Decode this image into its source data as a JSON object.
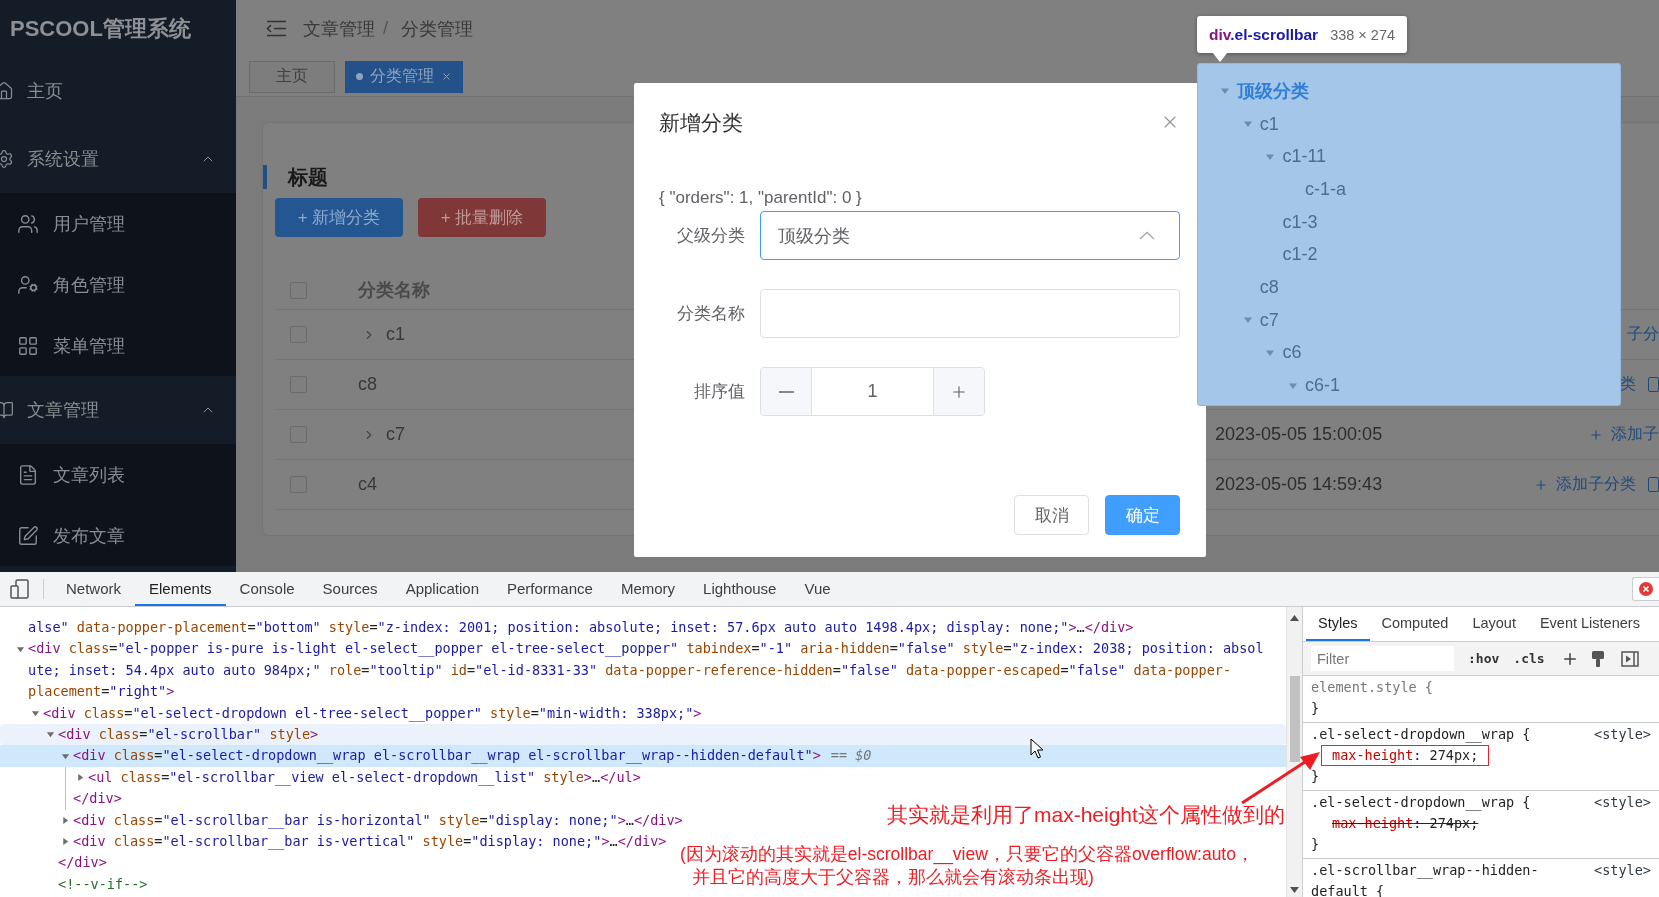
{
  "sidebar": {
    "logo": "PSCOOL管理系统",
    "items": [
      {
        "label": "主页"
      },
      {
        "label": "系统设置",
        "expanded": true,
        "children": [
          {
            "label": "用户管理"
          },
          {
            "label": "角色管理"
          },
          {
            "label": "菜单管理"
          }
        ]
      },
      {
        "label": "文章管理",
        "expanded": true,
        "children": [
          {
            "label": "文章列表"
          },
          {
            "label": "发布文章"
          }
        ]
      }
    ]
  },
  "header": {
    "breadcrumb": [
      "文章管理",
      "分类管理"
    ],
    "separator": "/"
  },
  "tabs": [
    {
      "label": "主页",
      "selected": false
    },
    {
      "label": "分类管理",
      "selected": true
    }
  ],
  "card": {
    "title": "标题",
    "buttons": [
      {
        "label": "+ 新增分类",
        "kind": "primary"
      },
      {
        "label": "+ 批量删除",
        "kind": "danger"
      }
    ],
    "table": {
      "header_checked": false,
      "columns": [
        "分类名称"
      ],
      "rows": [
        {
          "checked": false,
          "name": "c1",
          "expanded": false,
          "action": {
            "text": "子分",
            "kind": "text"
          }
        },
        {
          "checked": false,
          "name": "c8",
          "action": {
            "text": "类",
            "kind": "text-edit"
          }
        },
        {
          "checked": false,
          "name": "c7",
          "expanded": false,
          "date": "2023-05-05 15:00:05",
          "action": {
            "text": "添加子",
            "kind": "plus-text"
          }
        },
        {
          "checked": false,
          "name": "c4",
          "date": "2023-05-05 14:59:43",
          "action": {
            "text": "添加子分类",
            "kind": "plus-text-edit"
          }
        }
      ]
    }
  },
  "dialog": {
    "title": "新增分类",
    "debug_text": "{ \"orders\": 1, \"parentId\": 0 }",
    "fields": [
      {
        "kind": "select",
        "label": "父级分类",
        "value": "顶级分类",
        "open": true
      },
      {
        "kind": "text",
        "label": "分类名称"
      },
      {
        "kind": "number",
        "label": "排序值",
        "value": "1"
      }
    ],
    "buttons": [
      {
        "label": "取消",
        "kind": "default"
      },
      {
        "label": "确定",
        "kind": "primary"
      }
    ]
  },
  "tree_popper": {
    "nodes": [
      {
        "label": "顶级分类",
        "selected": true,
        "expanded": true,
        "children": [
          {
            "label": "c1",
            "selected": false,
            "expanded": true,
            "children": [
              {
                "label": "c1-11",
                "selected": false,
                "expanded": true,
                "children": [
                  {
                    "label": "c-1-a",
                    "selected": false
                  }
                ]
              },
              {
                "label": "c1-3",
                "selected": false
              },
              {
                "label": "c1-2",
                "selected": false
              }
            ]
          },
          {
            "label": "c8",
            "selected": false
          },
          {
            "label": "c7",
            "selected": false,
            "expanded": true,
            "children": [
              {
                "label": "c6",
                "selected": false,
                "expanded": true,
                "children": [
                  {
                    "label": "c6-1",
                    "selected": false,
                    "expanded": true
                  }
                ]
              }
            ]
          }
        ]
      }
    ]
  },
  "inspect_tooltip": {
    "tag": "div",
    "class": ".el-scrollbar",
    "size": "338 × 274"
  },
  "devtools": {
    "tabs": [
      {
        "label": "Network",
        "selected": false
      },
      {
        "label": "Elements",
        "selected": true
      },
      {
        "label": "Console",
        "selected": false
      },
      {
        "label": "Sources",
        "selected": false
      },
      {
        "label": "Application",
        "selected": false
      },
      {
        "label": "Performance",
        "selected": false
      },
      {
        "label": "Memory",
        "selected": false
      },
      {
        "label": "Lighthouse",
        "selected": false
      },
      {
        "label": "Vue",
        "selected": false
      }
    ],
    "elements": {
      "nodes": [
        {
          "lines": [
            {
              "text": "alse\" data-popper-placement=\"bottom\" style=\"z-index: 2001; position: absolute; inset: 57.6px auto auto 1498.4px; display: none;\">…</div>"
            }
          ],
          "selected": false,
          "hovered": false
        },
        {
          "lines": [
            {
              "text": "<div class=\"el-popper is-pure is-light el-select__popper el-tree-select__popper\" tabindex=\"-1\" aria-hidden=\"false\" style=\"z-index: 2038; position: absol"
            },
            {
              "text": "ute; inset: 54.4px auto auto 984px;\" role=\"tooltip\" id=\"el-id-8331-33\" data-popper-reference-hidden=\"false\" data-popper-escaped=\"false\" data-popper-"
            },
            {
              "text": "placement=\"right\">"
            }
          ],
          "expanded": true,
          "selected": false,
          "hovered": false,
          "children": [
            {
              "lines": [
                {
                  "text": "<div class=\"el-select-dropdown el-tree-select__popper\" style=\"min-width: 338px;\">"
                }
              ],
              "expanded": true,
              "selected": false,
              "hovered": false,
              "children": [
                {
                  "lines": [
                    {
                      "text": "<div class=\"el-scrollbar\" style>"
                    }
                  ],
                  "expanded": true,
                  "selected": false,
                  "hovered": true,
                  "closing": "</div>",
                  "children": [
                    {
                      "lines": [
                        {
                          "text": "<div class=\"el-select-dropdown__wrap el-scrollbar__wrap el-scrollbar__wrap--hidden-default\">"
                        }
                      ],
                      "marker": "== $0",
                      "expanded": true,
                      "selected": true,
                      "hovered": false,
                      "closing": "</div>",
                      "children": [
                        {
                          "lines": [
                            {
                              "text": "<ul class=\"el-scrollbar__view el-select-dropdown__list\" style>…</ul>"
                            }
                          ],
                          "expanded": false,
                          "selected": false,
                          "hovered": false
                        }
                      ]
                    },
                    {
                      "lines": [
                        {
                          "text": "<div class=\"el-scrollbar__bar is-horizontal\" style=\"display: none;\">…</div>"
                        }
                      ],
                      "expanded": false,
                      "selected": false,
                      "hovered": false
                    },
                    {
                      "lines": [
                        {
                          "text": "<div class=\"el-scrollbar__bar is-vertical\" style=\"display: none;\">…</div>"
                        }
                      ],
                      "expanded": false,
                      "selected": false,
                      "hovered": false
                    }
                  ]
                },
                {
                  "lines": [
                    {
                      "text": "<!--v-if-->"
                    }
                  ],
                  "selected": false,
                  "hovered": false
                }
              ]
            }
          ]
        }
      ]
    },
    "styles": {
      "tabs": [
        {
          "label": "Styles",
          "selected": true
        },
        {
          "label": "Computed",
          "selected": false
        },
        {
          "label": "Layout",
          "selected": false
        },
        {
          "label": "Event Listeners",
          "selected": false
        }
      ],
      "filter_placeholder": "Filter",
      "tools": [
        ":hov",
        ".cls"
      ],
      "rules": [
        {
          "selector": [
            "element.style {"
          ],
          "closing": "}"
        },
        {
          "selector": [
            ".el-select-dropdown__wrap {"
          ],
          "source": "<style>",
          "declarations": [
            {
              "property": "max-height",
              "value": ": 274px;",
              "overridden": false,
              "highlighted": true
            }
          ],
          "closing": "}"
        },
        {
          "selector": [
            ".el-select-dropdown__wrap {"
          ],
          "source": "<style>",
          "declarations": [
            {
              "property": "max-height",
              "value": ": 274px;",
              "overridden": true,
              "highlighted": false
            }
          ],
          "closing": "}"
        },
        {
          "selector": [
            ".el-scrollbar__wrap--hidden-",
            "default {"
          ],
          "source": "<style>"
        }
      ]
    },
    "annotation": {
      "headline": "其实就是利用了max-height这个属性做到的",
      "note_lines": [
        "(因为滚动的其实就是el-scrollbar__view，只要它的父容器overflow:auto，",
        "并且它的高度大于父容器，那么就会有滚动条出现)"
      ]
    }
  }
}
